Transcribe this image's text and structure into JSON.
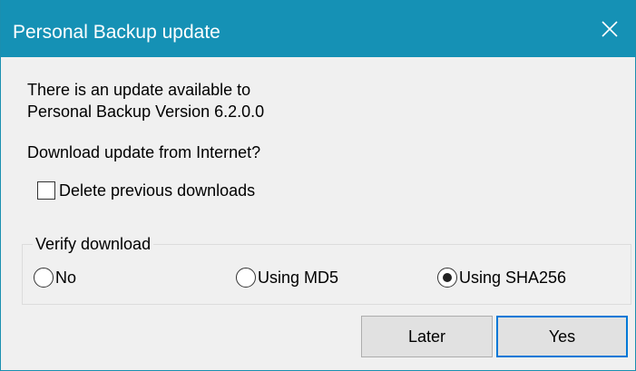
{
  "window": {
    "title": "Personal Backup update",
    "title_bar_color": "#1591b5",
    "close_icon": "close-icon"
  },
  "message": {
    "line1": "There is an update available to",
    "line2": "Personal Backup Version 6.2.0.0",
    "question": "Download update from Internet?"
  },
  "options": {
    "delete_previous": {
      "label": "Delete previous downloads",
      "checked": false
    }
  },
  "verify": {
    "group_label": "Verify download",
    "radios": [
      {
        "label": "No",
        "checked": false
      },
      {
        "label": "Using MD5",
        "checked": false
      },
      {
        "label": "Using SHA256",
        "checked": true
      }
    ]
  },
  "buttons": {
    "later": "Later",
    "yes": "Yes",
    "default_accent": "#0078d7"
  }
}
